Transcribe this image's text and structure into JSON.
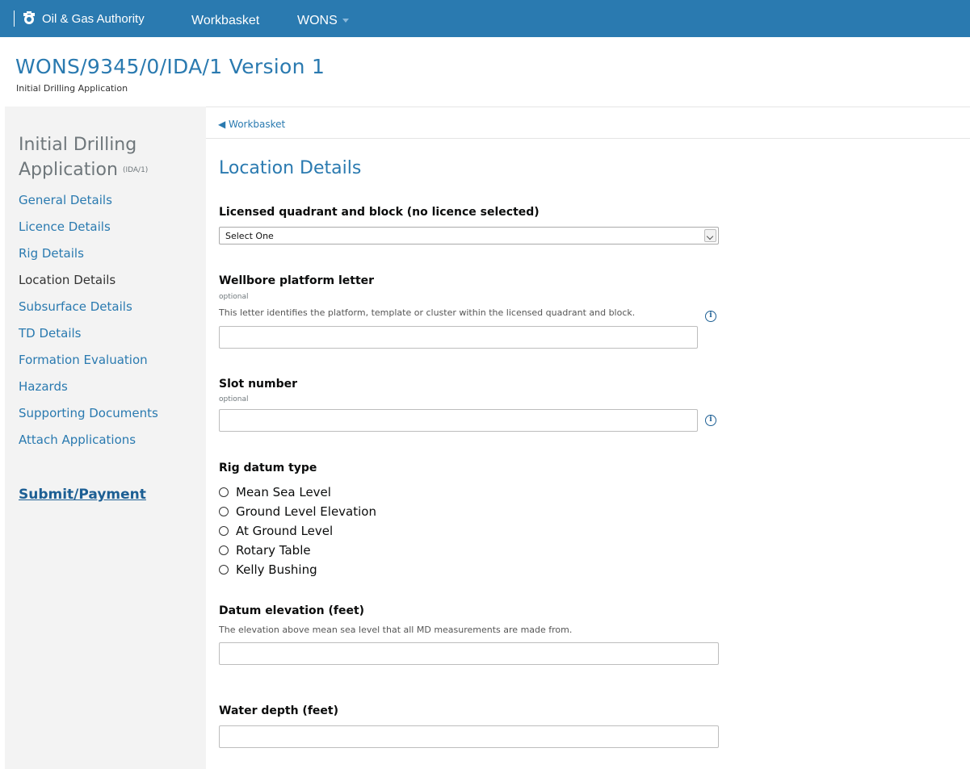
{
  "header": {
    "org_name": "Oil & Gas Authority",
    "nav": [
      {
        "label": "Workbasket"
      },
      {
        "label": "WONS"
      }
    ],
    "brand_color": "#2a7ab0"
  },
  "page": {
    "title": "WONS/9345/0/IDA/1 Version 1",
    "subtitle": "Initial Drilling Application"
  },
  "sidebar": {
    "heading_line1": "Initial Drilling",
    "heading_line2": "Application",
    "heading_code": "(IDA/1)",
    "items": [
      {
        "label": "General Details"
      },
      {
        "label": "Licence Details"
      },
      {
        "label": "Rig Details"
      },
      {
        "label": "Location Details"
      },
      {
        "label": "Subsurface Details"
      },
      {
        "label": "TD Details"
      },
      {
        "label": "Formation Evaluation"
      },
      {
        "label": "Hazards"
      },
      {
        "label": "Supporting Documents"
      },
      {
        "label": "Attach Applications"
      }
    ],
    "current_item": "Location Details",
    "submit_label": "Submit/Payment"
  },
  "breadcrumb": {
    "back_label": "◀ Workbasket"
  },
  "form": {
    "section_title": "Location Details",
    "quadrant": {
      "label": "Licensed quadrant and block (no licence selected)",
      "selected": "Select One"
    },
    "platform_letter": {
      "label": "Wellbore platform letter",
      "optional": "optional",
      "hint": "This letter identifies the platform, template or cluster within the licensed quadrant and block.",
      "value": ""
    },
    "slot_number": {
      "label": "Slot number",
      "optional": "optional",
      "value": ""
    },
    "rig_datum": {
      "label": "Rig datum type",
      "options": [
        {
          "label": "Mean Sea Level"
        },
        {
          "label": "Ground Level Elevation"
        },
        {
          "label": "At Ground Level"
        },
        {
          "label": "Rotary Table"
        },
        {
          "label": "Kelly Bushing"
        }
      ]
    },
    "datum_elevation": {
      "label": "Datum elevation (feet)",
      "hint": "The elevation above mean sea level that all MD measurements are made from.",
      "value": ""
    },
    "water_depth": {
      "label": "Water depth (feet)",
      "value": ""
    }
  },
  "icons": {
    "crest": "royal-crest-icon",
    "info": "info-icon",
    "dropdown": "chevron-down-icon"
  }
}
